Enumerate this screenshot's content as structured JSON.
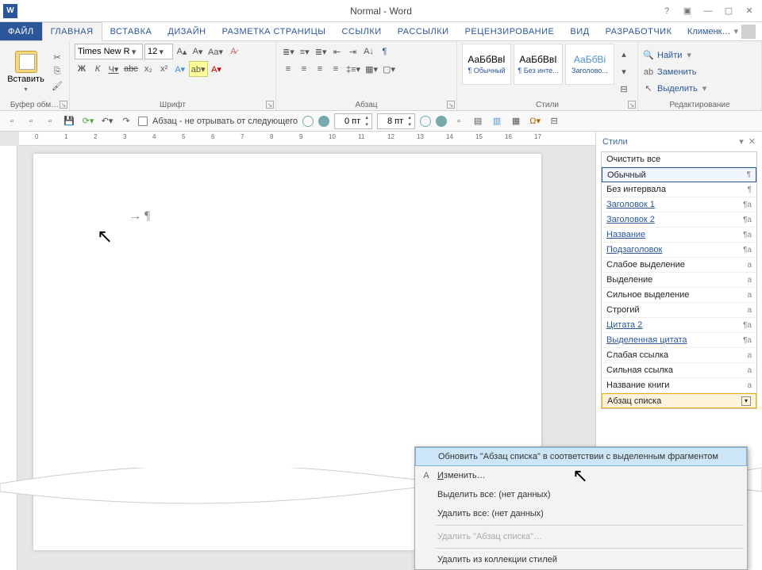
{
  "title": "Normal - Word",
  "user": "Клименк…",
  "tabs": {
    "file": "ФАЙЛ",
    "home": "ГЛАВНАЯ",
    "insert": "ВСТАВКА",
    "design": "ДИЗАЙН",
    "layout": "РАЗМЕТКА СТРАНИЦЫ",
    "refs": "ССЫЛКИ",
    "mail": "РАССЫЛКИ",
    "review": "РЕЦЕНЗИРОВАНИЕ",
    "view": "ВИД",
    "dev": "РАЗРАБОТЧИК"
  },
  "ribbon": {
    "clipboard": {
      "paste": "Вставить",
      "label": "Буфер обм…"
    },
    "font": {
      "name": "Times New R",
      "size": "12",
      "label": "Шрифт"
    },
    "para": {
      "label": "Абзац"
    },
    "styles": {
      "label": "Стили",
      "s1": {
        "prev": "АаБбВвI",
        "lbl": "¶ Обычный"
      },
      "s2": {
        "prev": "АаБбВвI",
        "lbl": "¶ Без инте..."
      },
      "s3": {
        "prev": "АаБбВі",
        "lbl": "Заголово..."
      }
    },
    "edit": {
      "label": "Редактирование",
      "find": "Найти",
      "replace": "Заменить",
      "select": "Выделить"
    }
  },
  "qat": {
    "para_keep": "Абзац - не отрывать от следующего",
    "sp1": "0 пт",
    "sp2": "8 пт"
  },
  "pane": {
    "title": "Стили",
    "items": [
      {
        "t": "Очистить все",
        "s": ""
      },
      {
        "t": "Обычный",
        "s": "¶",
        "sel": true
      },
      {
        "t": "Без интервала",
        "s": "¶"
      },
      {
        "t": "Заголовок 1",
        "s": "¶a",
        "u": true
      },
      {
        "t": "Заголовок 2",
        "s": "¶a",
        "u": true
      },
      {
        "t": "Название",
        "s": "¶a",
        "u": true
      },
      {
        "t": "Подзаголовок",
        "s": "¶a",
        "u": true
      },
      {
        "t": "Слабое выделение",
        "s": "a"
      },
      {
        "t": "Выделение",
        "s": "a"
      },
      {
        "t": "Сильное выделение",
        "s": "a"
      },
      {
        "t": "Строгий",
        "s": "a"
      },
      {
        "t": "Цитата 2",
        "s": "¶a",
        "u": true
      },
      {
        "t": "Выделенная цитата",
        "s": "¶a",
        "u": true
      },
      {
        "t": "Слабая ссылка",
        "s": "a"
      },
      {
        "t": "Сильная ссылка",
        "s": "a"
      },
      {
        "t": "Название книги",
        "s": "a"
      },
      {
        "t": "Абзац списка",
        "s": "",
        "hov": true,
        "dd": true
      }
    ]
  },
  "ctx": {
    "update": "Обновить \"Абзац списка\" в соответствии с выделенным фрагментом",
    "modify": "Изменить…",
    "selall": "Выделить все: (нет данных)",
    "delall": "Удалить все: (нет данных)",
    "delstyle": "Удалить \"Абзац списка\"…",
    "remove": "Удалить из коллекции стилей"
  }
}
